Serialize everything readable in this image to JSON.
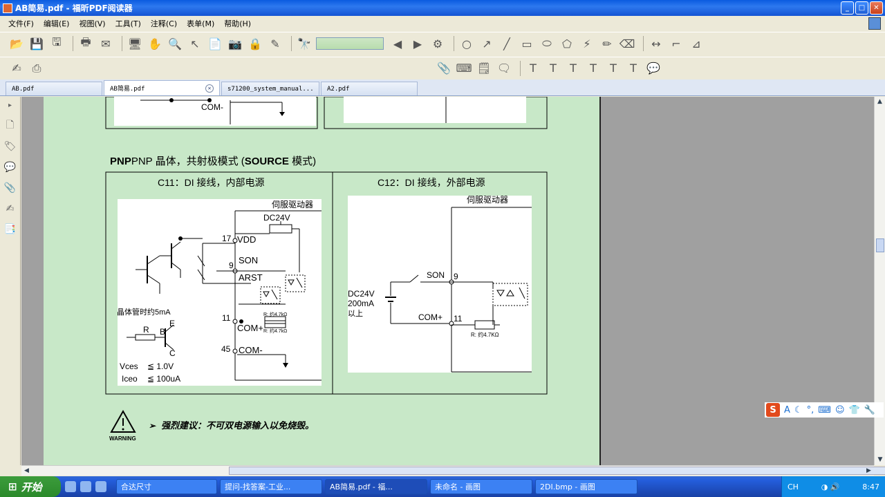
{
  "window": {
    "title": "AB简易.pdf - 福昕PDF阅读器"
  },
  "menu": [
    "文件(F)",
    "编辑(E)",
    "视图(V)",
    "工具(T)",
    "注释(C)",
    "表单(M)",
    "帮助(H)"
  ],
  "tabs": [
    {
      "label": "AB.pdf"
    },
    {
      "label": "AB简易.pdf"
    },
    {
      "label": "s71200_system_manual..."
    },
    {
      "label": "A2.pdf"
    }
  ],
  "doc": {
    "heading_a": "PNP 晶体，共射极模式 (",
    "heading_b": "SOURCE",
    "heading_c": " 模式)",
    "top_com_label": "COM-",
    "c11_title": "C11：DI 接线，内部电源",
    "c12_title": "C12：DI 接线，外部电源",
    "servo": "伺服驱动器",
    "dc24v": "DC24V",
    "vdd": "VDD",
    "pin17": "17",
    "pin9": "9",
    "son": "SON",
    "arst": "ARST",
    "pin11": "11",
    "comp": "COM+",
    "pin45": "45",
    "comm": "COM-",
    "r_label": "R: 约4.7kΩ",
    "transistor_note": "晶体管时约5mA",
    "r": "R",
    "b": "B",
    "e": "E",
    "c": "C",
    "vces": "Vces",
    "vces_val": "≦ 1.0V",
    "iceo": "Iceo",
    "iceo_val": "≦ 100uA",
    "c12_dc24v": "DC24V",
    "c12_200ma": "200mA",
    "c12_above": "以上",
    "c12_son": "SON",
    "c12_pin9": "9",
    "c12_comp": "COM+",
    "c12_pin11": "11",
    "c12_r": "R: 约4.7KΩ",
    "warning_word": "WARNING",
    "warning_text": "强烈建议：不可双电源输入以免烧毁。"
  },
  "ime": {
    "logo": "S",
    "mode": "A"
  },
  "taskbar": {
    "start": "开始",
    "tasks": [
      "合达尺寸",
      "提问-找答案-工业...",
      "AB简易.pdf - 福...",
      "未命名 - 画图",
      "2DI.bmp - 画图"
    ],
    "lang": "CH",
    "clock": "8:47"
  }
}
